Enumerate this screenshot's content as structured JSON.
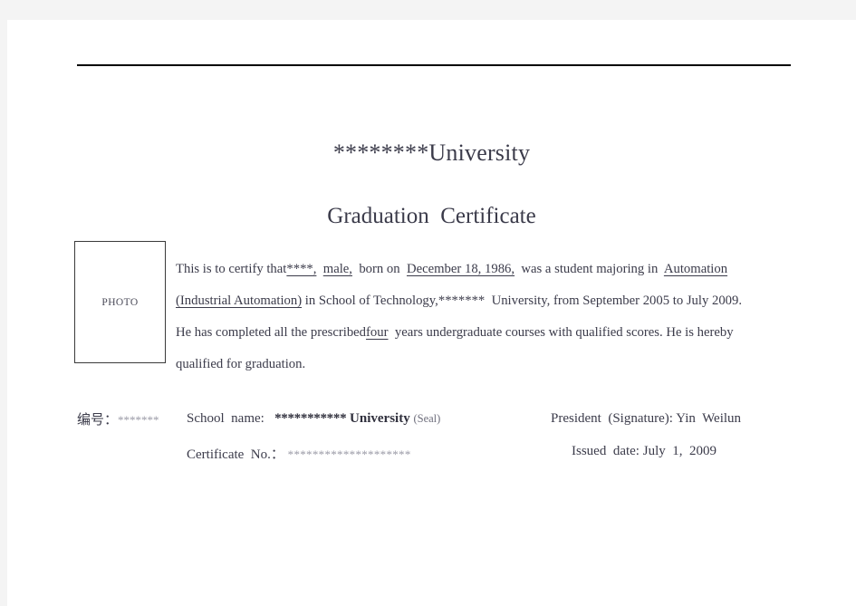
{
  "document": {
    "type": "graduation-certificate",
    "university_heading": "********University",
    "certificate_heading": "Graduation  Certificate",
    "photo_placeholder": "PHOTO"
  },
  "body": {
    "line1": {
      "pre": "This  is  to  certify  that",
      "name_redacted": "****,",
      "gender": "male,",
      "mid": "born  on",
      "birth_date": "December  18,  1986,",
      "post": "was  a  student  majoring  in",
      "major": "Automation"
    },
    "line2": {
      "major_cont": "(Industrial  Automation)",
      "mid": "in  School  of  Technology,",
      "university_redacted": "*******",
      "post": "University,  from  September  2005  to  July  2009."
    },
    "line3": {
      "pre": "He  has  completed  all  the  prescribed",
      "duration": "four",
      "post": "years  undergraduate  courses  with  qualified  scores.  He  is  hereby"
    },
    "line4": {
      "text": "qualified  for  graduation."
    }
  },
  "footer": {
    "serial_label": "编号：",
    "serial_value": "*******",
    "school_name_label": "School  name:",
    "school_name_redacted": "***********",
    "school_name_suffix": "University",
    "seal_note": "(Seal)",
    "certificate_no_label": "Certificate  No.：",
    "certificate_no_value": "********************",
    "president_label": "President  (Signature):",
    "president_name": "Yin  Weilun",
    "issued_date_label": "Issued  date:",
    "issued_date_value": "July  1,  2009"
  },
  "colors": {
    "page_background": "#ffffff",
    "canvas_background": "#f4f4f4",
    "text": "#3b3b4a",
    "muted_text": "#9a9aa6",
    "rule": "#000000"
  }
}
